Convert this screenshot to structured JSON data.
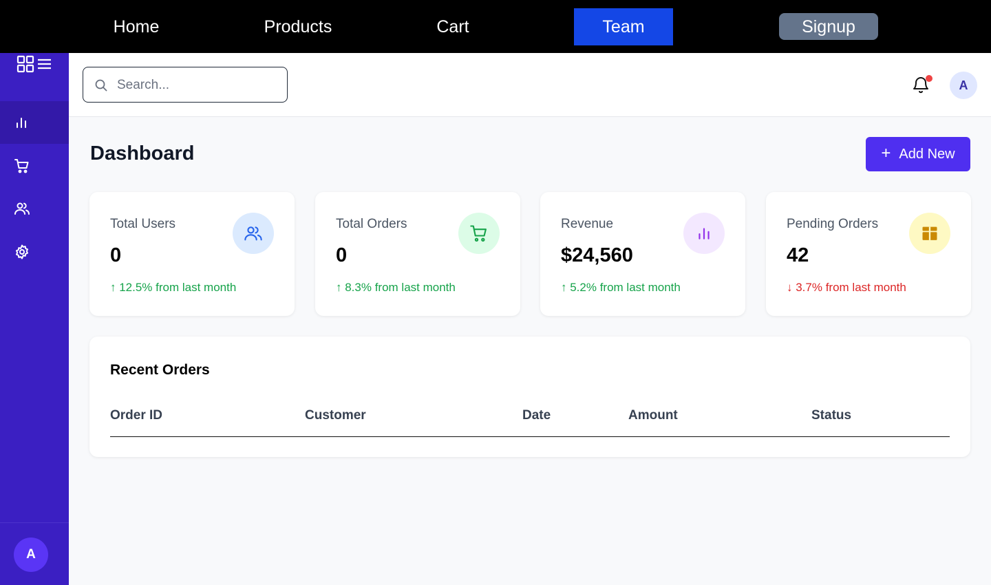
{
  "topnav": {
    "links": [
      {
        "label": "Home"
      },
      {
        "label": "Products"
      },
      {
        "label": "Cart"
      },
      {
        "label": "Team"
      }
    ],
    "active": "Team",
    "signup_label": "Signup"
  },
  "sidebar": {
    "items": [
      {
        "icon": "chart-bar-icon",
        "active": true
      },
      {
        "icon": "cart-icon",
        "active": false
      },
      {
        "icon": "users-icon",
        "active": false
      },
      {
        "icon": "gear-icon",
        "active": false
      }
    ],
    "avatar_initial": "A"
  },
  "header": {
    "search_placeholder": "Search...",
    "avatar_initial": "A"
  },
  "main": {
    "title": "Dashboard",
    "add_button_label": "Add New",
    "cards": [
      {
        "label": "Total Users",
        "value": "0",
        "change": "↑ 12.5% from last month",
        "trend": "up",
        "icon": "users-icon",
        "icon_bg": "#dbeafe",
        "icon_color": "#2563eb"
      },
      {
        "label": "Total Orders",
        "value": "0",
        "change": "↑ 8.3% from last month",
        "trend": "up",
        "icon": "cart-icon",
        "icon_bg": "#dcfce7",
        "icon_color": "#16a34a"
      },
      {
        "label": "Revenue",
        "value": "$24,560",
        "change": "↑ 5.2% from last month",
        "trend": "up",
        "icon": "chart-bar-icon",
        "icon_bg": "#f3e8ff",
        "icon_color": "#9333ea"
      },
      {
        "label": "Pending Orders",
        "value": "42",
        "change": "↓ 3.7% from last month",
        "trend": "down",
        "icon": "box-icon",
        "icon_bg": "#fef9c3",
        "icon_color": "#ca8a04"
      }
    ],
    "recent_orders": {
      "title": "Recent Orders",
      "columns": [
        "Order ID",
        "Customer",
        "Date",
        "Amount",
        "Status"
      ]
    }
  },
  "colors": {
    "sidebar": "#3b1fc2",
    "accent": "#4f2ff0",
    "nav_active": "#1447e6"
  }
}
